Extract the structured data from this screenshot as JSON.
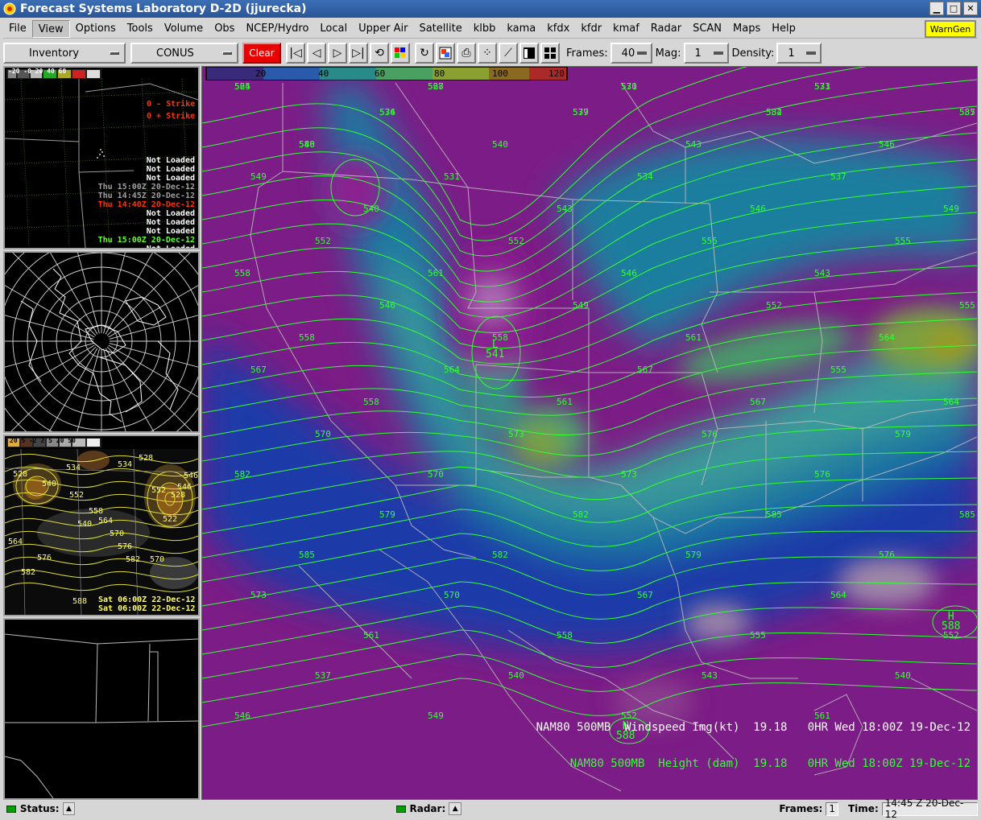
{
  "window": {
    "title": "Forecast Systems Laboratory D-2D (jjurecka)",
    "buttons": [
      "minimize",
      "maximize",
      "close"
    ]
  },
  "menu": {
    "items": [
      "File",
      "View",
      "Options",
      "Tools",
      "Volume",
      "Obs",
      "NCEP/Hydro",
      "Local",
      "Upper Air",
      "Satellite",
      "klbb",
      "kama",
      "kfdx",
      "kfdr",
      "kmaf",
      "Radar",
      "SCAN",
      "Maps",
      "Help"
    ],
    "active": "View",
    "warngen": "WarnGen"
  },
  "toolbar": {
    "inventory": "Inventory",
    "scale": "CONUS",
    "clear": "Clear",
    "frames_label": "Frames:",
    "frames_value": "40",
    "mag_label": "Mag:",
    "mag_value": "1",
    "density_label": "Density:",
    "density_value": "1",
    "icons": [
      "first-frame-icon",
      "prev-frame-icon",
      "next-frame-icon",
      "last-frame-icon",
      "loop-icon",
      "color-table-icon",
      "refresh-icon",
      "image-combine-icon",
      "print-icon",
      "points-icon",
      "baseline-icon",
      "single-panel-icon",
      "four-panel-icon"
    ]
  },
  "panes": {
    "pane1": {
      "scale_labels": [
        "-20",
        "-0",
        "20",
        "40",
        "60"
      ],
      "lightning": [
        "0 - Strike",
        "0 + Strike"
      ],
      "lines": [
        {
          "text": "Not Loaded",
          "color": "#ffffff"
        },
        {
          "text": "Not Loaded",
          "color": "#ffffff"
        },
        {
          "text": "Not Loaded",
          "color": "#ffffff"
        },
        {
          "text": "Thu 15:00Z 20-Dec-12",
          "color": "#a0a0a0"
        },
        {
          "text": "Thu 14:45Z 20-Dec-12",
          "color": "#a0a0a0"
        },
        {
          "text": "Thu 14:40Z 20-Dec-12",
          "color": "#ff3300"
        },
        {
          "text": "Not Loaded",
          "color": "#ffffff"
        },
        {
          "text": "Not Loaded",
          "color": "#ffffff"
        },
        {
          "text": "Not Loaded",
          "color": "#ffffff"
        },
        {
          "text": "Thu 15:00Z 20-Dec-12",
          "color": "#66ff33"
        },
        {
          "text": "Not Loaded",
          "color": "#ffffff"
        }
      ]
    },
    "pane3": {
      "scale_labels": [
        "20",
        "5",
        "-2",
        "2",
        "5",
        "20",
        "50"
      ],
      "contour_labels": [
        "528",
        "534",
        "534",
        "528",
        "546",
        "546",
        "540",
        "552",
        "558",
        "564",
        "570",
        "576",
        "582",
        "588",
        "540",
        "552",
        "522",
        "528",
        "564",
        "576",
        "570",
        "582"
      ],
      "times": [
        "Sat 06:00Z 22-Dec-12",
        "Sat 06:00Z 22-Dec-12"
      ]
    }
  },
  "main": {
    "colorbar_labels": [
      "20",
      "40",
      "60",
      "80",
      "100",
      "120"
    ],
    "contour_labels": [
      "525",
      "528",
      "531",
      "531",
      "534",
      "537",
      "534",
      "537",
      "540",
      "540",
      "543",
      "546",
      "549",
      "531",
      "534",
      "537",
      "540",
      "543",
      "546",
      "549",
      "552",
      "552",
      "555",
      "555",
      "558",
      "561",
      "546",
      "543",
      "546",
      "549",
      "552",
      "555",
      "558",
      "558",
      "561",
      "564",
      "567",
      "564",
      "567",
      "555",
      "558",
      "561",
      "567",
      "564",
      "570",
      "573",
      "576",
      "579",
      "582",
      "570",
      "573",
      "576",
      "579",
      "582",
      "585",
      "585",
      "585",
      "582",
      "579",
      "576",
      "573",
      "570",
      "567",
      "564",
      "561",
      "558",
      "555",
      "552",
      "537",
      "540",
      "543",
      "540",
      "546",
      "549",
      "552",
      "561",
      "564",
      "567",
      "570",
      "573",
      "576",
      "579",
      "582",
      "585",
      "588"
    ],
    "low_label": "L",
    "low_value": "541",
    "high_labels": [
      {
        "letter": "H",
        "value": "588"
      },
      {
        "letter": "H",
        "value": "588"
      }
    ],
    "legend": [
      {
        "product": "NAM80 500MB",
        "field": "Windspeed Img(kt)",
        "value": "19.18",
        "time": "0HR Wed 18:00Z 19-Dec-12"
      },
      {
        "product": "NAM80 500MB",
        "field": "Height (dam)",
        "value": "19.18",
        "time": "0HR Wed 18:00Z 19-Dec-12"
      }
    ]
  },
  "status": {
    "status_label": "Status:",
    "radar_label": "Radar:",
    "frames_label": "Frames:",
    "frames_value": "1",
    "time_label": "Time:",
    "time_value": "14:45 Z 20-Dec-12"
  },
  "colors": {
    "title_bar": "#2a5597",
    "clear_button": "#e80000",
    "warngen": "#ffff00",
    "contour": "#33ff33",
    "map_border": "#c0c0c0"
  }
}
